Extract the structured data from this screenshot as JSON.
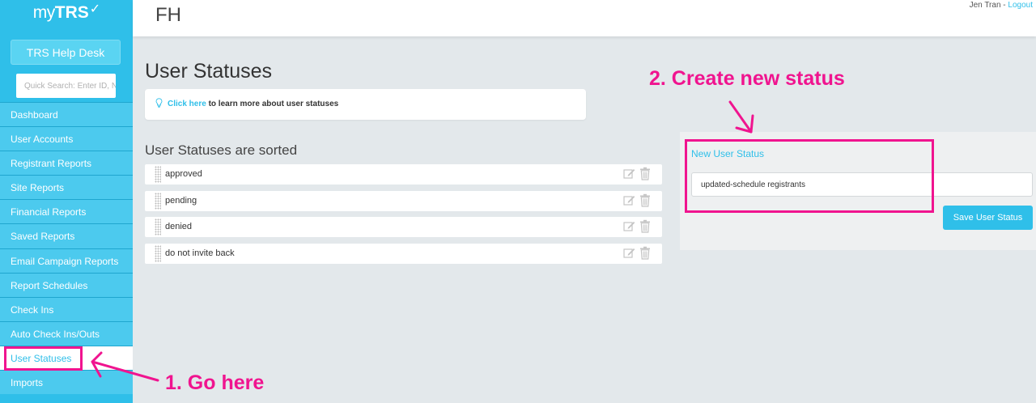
{
  "app": {
    "logo_my": "my",
    "logo_trs": "TRS",
    "logo_check": "✓"
  },
  "sidebar": {
    "help_desk_label": "TRS Help Desk",
    "search_placeholder": "Quick Search: Enter ID, N",
    "items": [
      {
        "label": "Dashboard"
      },
      {
        "label": "User Accounts"
      },
      {
        "label": "Registrant Reports"
      },
      {
        "label": "Site Reports"
      },
      {
        "label": "Financial Reports"
      },
      {
        "label": "Saved Reports"
      },
      {
        "label": "Email Campaign Reports"
      },
      {
        "label": "Report Schedules"
      },
      {
        "label": "Check Ins"
      },
      {
        "label": "Auto Check Ins/Outs"
      },
      {
        "label": "User Statuses",
        "active": true
      },
      {
        "label": "Imports"
      }
    ]
  },
  "header": {
    "org": "FH",
    "user_name": "Jen Tran",
    "separator": " - ",
    "logout_label": "Logout"
  },
  "main": {
    "page_title": "User Statuses",
    "info_link": "Click here",
    "info_rest": " to learn more about user statuses",
    "sorted_title": "User Statuses are sorted",
    "statuses": [
      {
        "label": "approved"
      },
      {
        "label": "pending"
      },
      {
        "label": "denied"
      },
      {
        "label": "do not invite back"
      }
    ]
  },
  "new_status": {
    "title": "New User Status",
    "input_value": "updated-schedule registrants",
    "save_label": "Save User Status"
  },
  "annotations": {
    "step1": "1. Go here",
    "step2": "2. Create new status",
    "color": "#f0148f"
  },
  "colors": {
    "accent": "#2fbfe9",
    "sidebar": "#2fbfe9",
    "annotation": "#f0148f"
  }
}
